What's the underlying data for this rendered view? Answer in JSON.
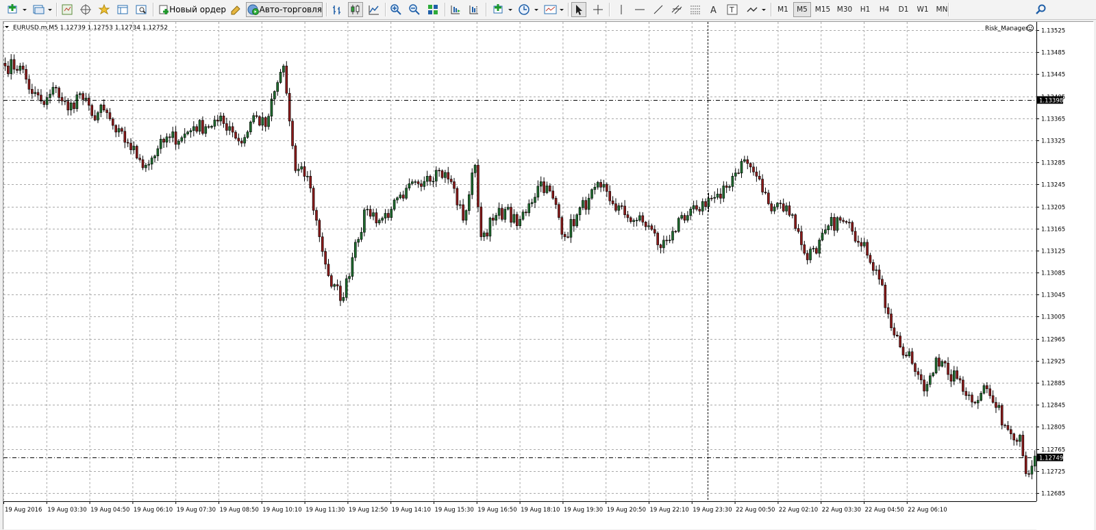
{
  "toolbar": {
    "new_order_label": "Новый ордер",
    "autotrading_label": "Авто-торговля",
    "timeframes": [
      "M1",
      "M5",
      "M15",
      "M30",
      "H1",
      "H4",
      "D1",
      "W1",
      "MN"
    ],
    "active_timeframe": "M5",
    "icons": [
      "new-chart-icon",
      "profiles-icon",
      "market-watch-icon",
      "navigator-icon",
      "favorites-icon",
      "data-window-icon",
      "strategy-tester-icon",
      "new-order-icon",
      "metaeditor-icon",
      "autotrading-icon",
      "bar-chart-icon",
      "candlestick-icon",
      "line-chart-icon",
      "zoom-in-icon",
      "zoom-out-icon",
      "tile-windows-icon",
      "scroll-chart-icon",
      "chart-shift-icon",
      "indicators-icon",
      "periods-icon",
      "templates-icon",
      "cursor-icon",
      "crosshair-icon",
      "vertical-line-icon",
      "horizontal-line-icon",
      "trendline-icon",
      "fibo-icon",
      "channel-icon",
      "text-icon",
      "text-label-icon",
      "arrows-icon",
      "search-icon"
    ]
  },
  "chart": {
    "header": "EURUSD.m,M5  1.12739 1.12753 1.12734 1.12752",
    "indicator_label": "Risk_Manager",
    "line_price_label": "1.13398",
    "current_price_label": "1.12749",
    "price_labels": [
      "1.13525",
      "1.13485",
      "1.13445",
      "1.13405",
      "1.13365",
      "1.13325",
      "1.13285",
      "1.13245",
      "1.13205",
      "1.13165",
      "1.13125",
      "1.13085",
      "1.13045",
      "1.13005",
      "1.12965",
      "1.12925",
      "1.12885",
      "1.12845",
      "1.12805",
      "1.12765",
      "1.12725",
      "1.12685"
    ],
    "time_labels": [
      "19 Aug 2016",
      "19 Aug 03:30",
      "19 Aug 04:50",
      "19 Aug 06:10",
      "19 Aug 07:30",
      "19 Aug 08:50",
      "19 Aug 10:10",
      "19 Aug 11:30",
      "19 Aug 12:50",
      "19 Aug 14:10",
      "19 Aug 15:30",
      "19 Aug 16:50",
      "19 Aug 18:10",
      "19 Aug 19:30",
      "19 Aug 20:50",
      "19 Aug 22:10",
      "19 Aug 23:30",
      "22 Aug 00:50",
      "22 Aug 02:10",
      "22 Aug 03:30",
      "22 Aug 04:50",
      "22 Aug 06:10"
    ],
    "colors": {
      "bull": "#1e6b2e",
      "bear": "#8b1a1a",
      "wick": "#000000",
      "grid": "#a8a8a8",
      "background": "#ffffff"
    }
  },
  "chart_data": {
    "type": "candlestick",
    "symbol": "EURUSD.m",
    "timeframe": "M5",
    "ylim": [
      1.1267,
      1.1354
    ],
    "horizontal_level": 1.13398,
    "current_price": 1.12749,
    "anchor_closes": [
      [
        0,
        1.1346
      ],
      [
        5,
        1.1346
      ],
      [
        9,
        1.1341
      ],
      [
        13,
        1.1339
      ],
      [
        17,
        1.1342
      ],
      [
        21,
        1.1338
      ],
      [
        25,
        1.1341
      ],
      [
        29,
        1.1337
      ],
      [
        33,
        1.1338
      ],
      [
        37,
        1.1334
      ],
      [
        41,
        1.1332
      ],
      [
        45,
        1.1329
      ],
      [
        47,
        1.1328
      ],
      [
        51,
        1.1331
      ],
      [
        55,
        1.1333
      ],
      [
        59,
        1.1333
      ],
      [
        63,
        1.1335
      ],
      [
        67,
        1.1335
      ],
      [
        71,
        1.1336
      ],
      [
        75,
        1.1335
      ],
      [
        79,
        1.1332
      ],
      [
        83,
        1.1337
      ],
      [
        87,
        1.1335
      ],
      [
        91,
        1.1343
      ],
      [
        93,
        1.1346
      ],
      [
        95,
        1.1336
      ],
      [
        97,
        1.1327
      ],
      [
        101,
        1.1326
      ],
      [
        105,
        1.1315
      ],
      [
        109,
        1.1306
      ],
      [
        113,
        1.1304
      ],
      [
        117,
        1.1314
      ],
      [
        121,
        1.132
      ],
      [
        125,
        1.1318
      ],
      [
        129,
        1.132
      ],
      [
        133,
        1.1322
      ],
      [
        137,
        1.1325
      ],
      [
        141,
        1.1326
      ],
      [
        145,
        1.1327
      ],
      [
        149,
        1.1325
      ],
      [
        153,
        1.1318
      ],
      [
        157,
        1.1328
      ],
      [
        159,
        1.1315
      ],
      [
        163,
        1.1318
      ],
      [
        167,
        1.132
      ],
      [
        171,
        1.1317
      ],
      [
        175,
        1.1321
      ],
      [
        179,
        1.1325
      ],
      [
        183,
        1.1322
      ],
      [
        187,
        1.1315
      ],
      [
        191,
        1.1319
      ],
      [
        195,
        1.1322
      ],
      [
        199,
        1.1324
      ],
      [
        203,
        1.1321
      ],
      [
        207,
        1.1319
      ],
      [
        211,
        1.1318
      ],
      [
        215,
        1.1317
      ],
      [
        219,
        1.1313
      ],
      [
        223,
        1.1316
      ],
      [
        227,
        1.1318
      ],
      [
        231,
        1.132
      ],
      [
        235,
        1.1322
      ],
      [
        239,
        1.1322
      ],
      [
        243,
        1.1326
      ],
      [
        247,
        1.1329
      ],
      [
        251,
        1.1326
      ],
      [
        255,
        1.1321
      ],
      [
        259,
        1.1321
      ],
      [
        263,
        1.1319
      ],
      [
        267,
        1.1312
      ],
      [
        271,
        1.1312
      ],
      [
        275,
        1.1317
      ],
      [
        279,
        1.1318
      ],
      [
        283,
        1.1316
      ],
      [
        287,
        1.1314
      ],
      [
        291,
        1.1309
      ],
      [
        295,
        1.1301
      ],
      [
        299,
        1.1295
      ],
      [
        303,
        1.1292
      ],
      [
        307,
        1.1287
      ],
      [
        311,
        1.1293
      ],
      [
        315,
        1.129
      ],
      [
        319,
        1.1289
      ],
      [
        323,
        1.1285
      ],
      [
        327,
        1.1288
      ],
      [
        331,
        1.1284
      ],
      [
        335,
        1.128
      ],
      [
        339,
        1.1279
      ],
      [
        341,
        1.1272
      ],
      [
        344,
        1.12752
      ]
    ]
  }
}
